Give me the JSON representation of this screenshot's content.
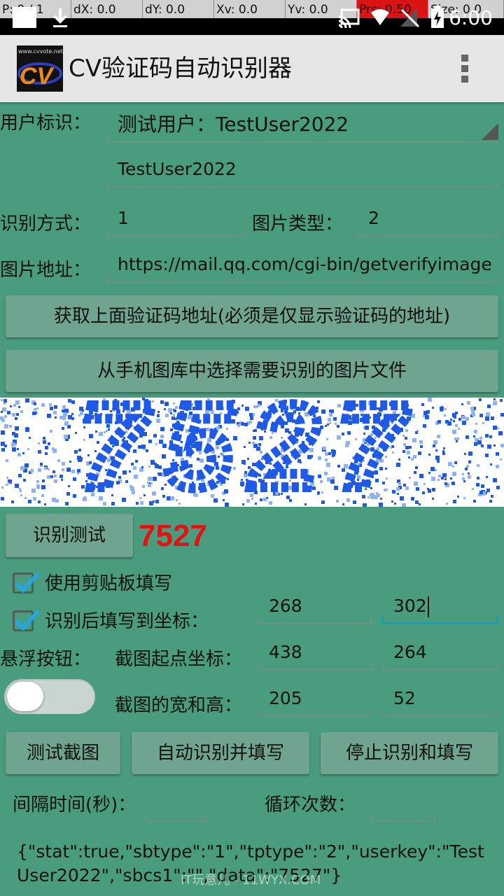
{
  "status_bar": {
    "debug": [
      "P: 0 / 1",
      "dX: 0.0",
      "dY: 0.0",
      "Xv: 0.0",
      "Yv: 0.0",
      "Prs: 0.50",
      "Size: 0.0"
    ],
    "time": "6:00"
  },
  "app": {
    "title": "CV验证码自动识别器",
    "logo_site_text": "www.cvvote.net",
    "logo_text": "CV"
  },
  "form": {
    "user_label": "用户标识：",
    "user_spinner_value": "测试用户：TestUser2022",
    "user_key_value": "TestUser2022",
    "recognize_mode_label": "识别方式：",
    "recognize_mode_value": "1",
    "image_type_label": "图片类型：",
    "image_type_value": "2",
    "image_url_label": "图片地址：",
    "image_url_value": "https://mail.qq.com/cgi-bin/getverifyimage"
  },
  "buttons": {
    "get_url": "获取上面验证码地址(必须是仅显示验证码的地址)",
    "pick_image": "从手机图库中选择需要识别的图片文件",
    "recognize_test": "识别测试",
    "test_capture": "测试截图",
    "auto_recognize": "自动识别并填写",
    "stop": "停止识别和填写"
  },
  "captcha": {
    "text": "7527"
  },
  "result": "7527",
  "options": {
    "use_clipboard_label": "使用剪贴板填写",
    "use_clipboard_checked": true,
    "fill_coord_label": "识别后填写到坐标：",
    "fill_coord_checked": true,
    "fill_x": "268",
    "fill_y": "302",
    "float_button_label": "悬浮按钮：",
    "float_button_on": false,
    "capture_origin_label": "截图起点坐标：",
    "capture_x": "438",
    "capture_y": "264",
    "capture_size_label": "截图的宽和高：",
    "capture_w": "205",
    "capture_h": "52",
    "interval_label": "间隔时间(秒)：",
    "interval_value": "",
    "loop_label": "循环次数：",
    "loop_value": ""
  },
  "output_json": "{\"stat\":true,\"sbtype\":\"1\",\"tptype\":\"2\",\"userkey\":\"TestUser2022\",\"sbcs1\":\"\",\"data\":\"7527\"}",
  "watermark": "IT玩意儿 - 11WYX.COM",
  "colors": {
    "background": "#4a9c7f",
    "button": "#6fa48f",
    "result": "#e01414",
    "focus": "#0aa0c8",
    "checkbox": "#2aa5dc",
    "captcha_ink": "#1f5ae6"
  }
}
